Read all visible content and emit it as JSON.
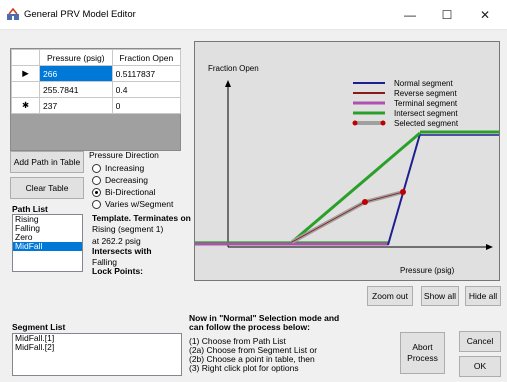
{
  "window": {
    "title": "General PRV Model Editor",
    "min": "—",
    "max": "☐",
    "close": "✕"
  },
  "table": {
    "headers": [
      "Pressure (psig)",
      "Fraction Open"
    ],
    "rows": [
      {
        "marker": "▶",
        "pressure": "266",
        "fraction": "0.5117837"
      },
      {
        "marker": "",
        "pressure": "255.7841",
        "fraction": "0.4"
      },
      {
        "marker": "✱",
        "pressure": "237",
        "fraction": "0"
      }
    ]
  },
  "buttons": {
    "add_path": "Add Path in Table",
    "clear_table": "Clear Table",
    "zoom_out": "Zoom out",
    "show_all": "Show all",
    "hide_all": "Hide all",
    "abort": "Abort Process",
    "cancel": "Cancel",
    "ok": "OK"
  },
  "pressure_direction": {
    "label": "Pressure Direction",
    "options": [
      "Increasing",
      "Decreasing",
      "Bi-Directional",
      "Varies w/Segment"
    ],
    "selected": "Bi-Directional"
  },
  "path_list": {
    "label": "Path List",
    "items": [
      "Rising",
      "Falling",
      "Zero",
      "MidFall"
    ],
    "selected": "MidFall"
  },
  "template": {
    "heading": "Template. Terminates on",
    "line1": "Rising  (segment 1)",
    "line2": "at 262.2 psig",
    "intersects_label": "Intersects with",
    "intersects_value": "Falling",
    "lock_points": "Lock Points:"
  },
  "segment_list": {
    "label": "Segment List",
    "items": [
      "MidFall.[1]",
      "MidFall.[2]"
    ]
  },
  "instructions": {
    "heading1": "Now in \"Normal\" Selection mode and",
    "heading2": "can follow the process below:",
    "lines": [
      "(1) Choose from Path List",
      "(2a) Choose from Segment List or",
      "(2b) Choose a point in table, then",
      "(3) Right click plot for options"
    ]
  },
  "plot": {
    "ylabel": "Fraction Open",
    "xlabel": "Pressure (psig)",
    "legend": [
      "Normal segment",
      "Reverse segment",
      "Terminal segment",
      "Intersect segment",
      "Selected segment"
    ],
    "colors": {
      "normal": "#1f1f8f",
      "reverse": "#8b1a1a",
      "terminal": "#b050b0",
      "intersect": "#2aa02a",
      "selected": "#a0a0a0",
      "selected_dot": "#c00000"
    }
  }
}
